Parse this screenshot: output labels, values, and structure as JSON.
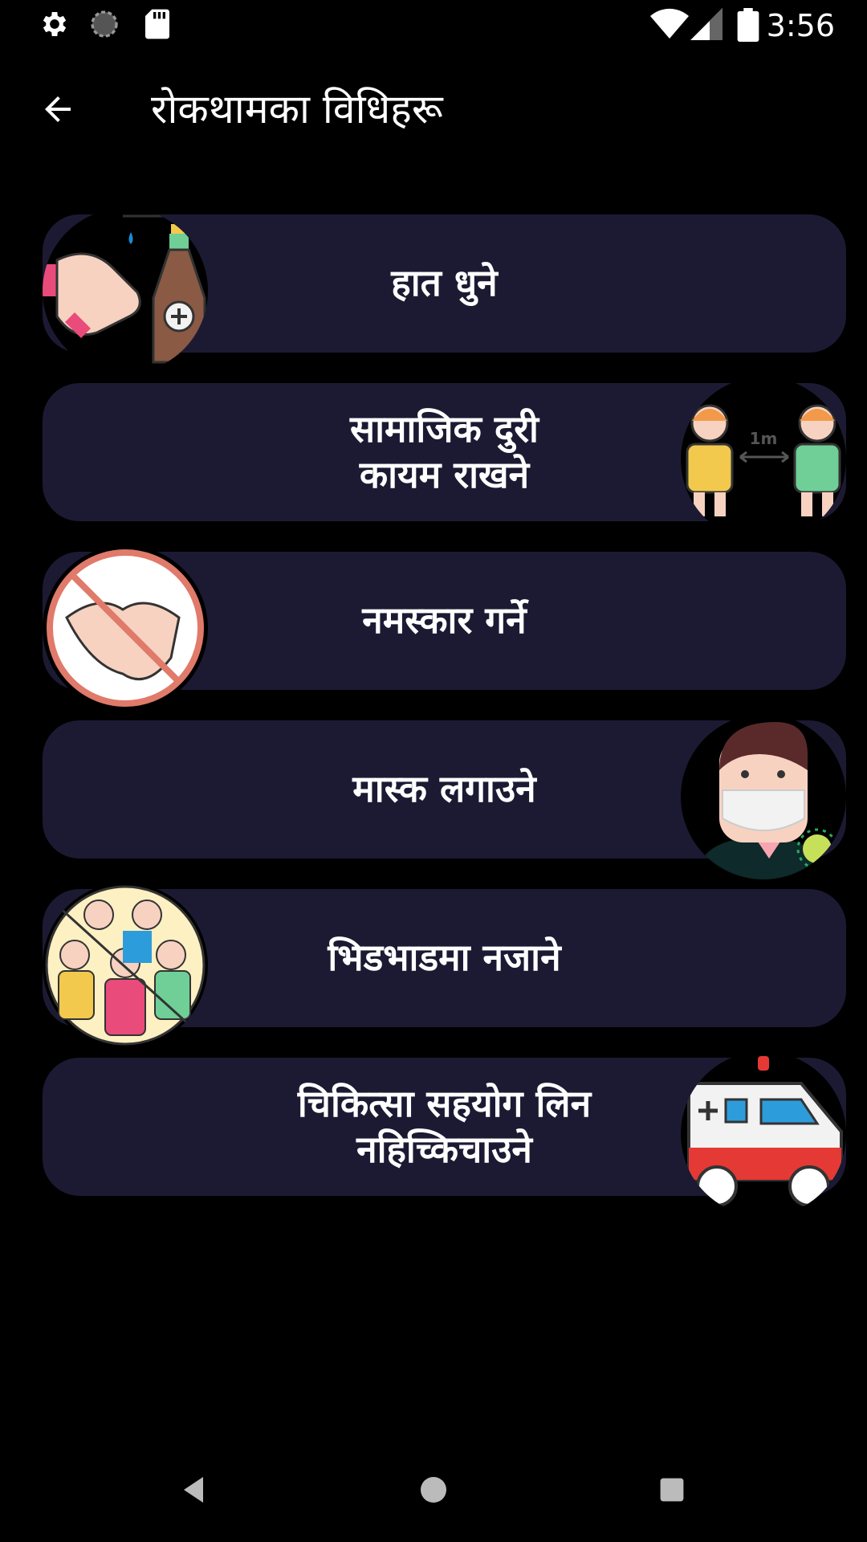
{
  "status_bar": {
    "time": "3:56",
    "icons": [
      "settings-icon",
      "sync-icon",
      "sd-card-icon",
      "wifi-icon",
      "signal-icon",
      "battery-icon"
    ]
  },
  "app_bar": {
    "title": "रोकथामका विधिहरू",
    "back_icon": "arrow-back-icon"
  },
  "cards": [
    {
      "label": "हात धुने",
      "illustration": "hand-wash-icon",
      "side": "left"
    },
    {
      "label": "सामाजिक दुरी\nकायम राखने",
      "illustration": "social-distance-icon",
      "side": "right",
      "distance_text": "1m"
    },
    {
      "label": "नमस्कार गर्ने",
      "illustration": "no-handshake-icon",
      "side": "left"
    },
    {
      "label": "मास्क लगाउने",
      "illustration": "mask-person-icon",
      "side": "right"
    },
    {
      "label": "भिडभाडमा नजाने",
      "illustration": "no-crowd-icon",
      "side": "left"
    },
    {
      "label": "चिकित्सा सहयोग लिन\nनहिच्किचाउने",
      "illustration": "ambulance-icon",
      "side": "right"
    }
  ],
  "nav_bar": {
    "icons": [
      "nav-back-icon",
      "nav-home-icon",
      "nav-recents-icon"
    ]
  }
}
